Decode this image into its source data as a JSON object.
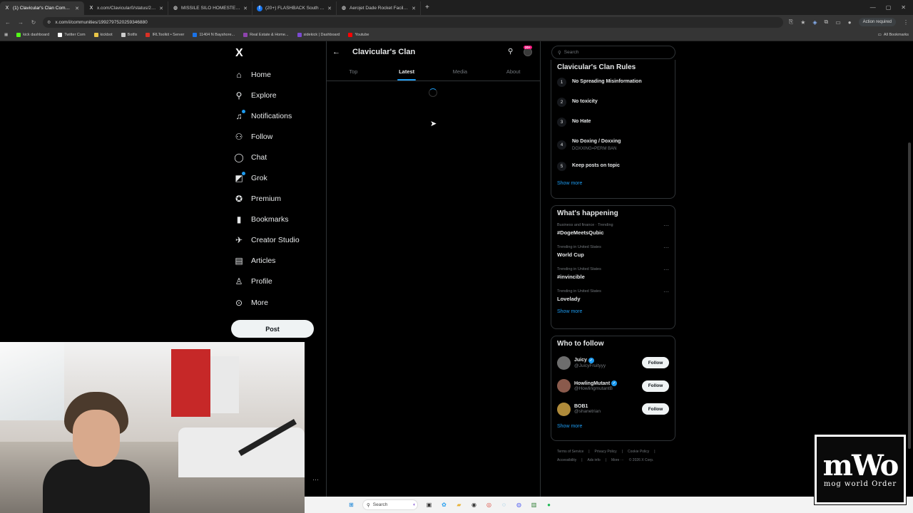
{
  "browser": {
    "tabs": [
      {
        "favicon": "X",
        "title": "(1) Clavicular's Clan Communit",
        "active": true
      },
      {
        "favicon": "X",
        "title": "x.com/Clavicular0/status/2039",
        "active": false
      },
      {
        "favicon": "◍",
        "title": "MISSILE SILO HOMESTEAD - Gr",
        "active": false
      },
      {
        "favicon": "f",
        "title": "(20+) FLASHBACK South Florid",
        "active": false
      },
      {
        "favicon": "◍",
        "title": "Aerojet Dade Rocket Facility | #",
        "active": false
      }
    ],
    "new_tab": "+",
    "url": "x.com/i/communities/1992797520259346880",
    "action_required": "Action required",
    "bookmarks": [
      {
        "label": "kick dashboard",
        "color": "#53fc18"
      },
      {
        "label": "Twitter Com",
        "color": "#ffffff"
      },
      {
        "label": "kickbot",
        "color": "#e8c547"
      },
      {
        "label": "Botfix",
        "color": "#cccccc"
      },
      {
        "label": "IRLToolkit • Server",
        "color": "#d93025"
      },
      {
        "label": "11404 N Bayshore...",
        "color": "#1a73e8"
      },
      {
        "label": "Real Estate & Home...",
        "color": "#8e44ad"
      },
      {
        "label": "sidekick | Dashboard",
        "color": "#7b4ad1"
      },
      {
        "label": "Youtube",
        "color": "#ff0000"
      }
    ],
    "all_bookmarks": "All Bookmarks"
  },
  "leftnav": {
    "logo": "X",
    "items": [
      {
        "label": "Home",
        "icon": "⌂"
      },
      {
        "label": "Explore",
        "icon": "⚲"
      },
      {
        "label": "Notifications",
        "icon": "🔔"
      },
      {
        "label": "Follow",
        "icon": "+"
      },
      {
        "label": "Chat",
        "icon": "◯"
      },
      {
        "label": "Grok",
        "icon": "◩"
      },
      {
        "label": "Premium",
        "icon": "✓"
      },
      {
        "label": "Bookmarks",
        "icon": "▮"
      },
      {
        "label": "Creator Studio",
        "icon": "✈"
      },
      {
        "label": "Articles",
        "icon": "▤"
      },
      {
        "label": "Profile",
        "icon": "♙"
      },
      {
        "label": "More",
        "icon": "⋯"
      }
    ],
    "post": "Post"
  },
  "community": {
    "title": "Clavicular's Clan",
    "badge": "20+",
    "tabs": [
      "Top",
      "Latest",
      "Media",
      "About"
    ],
    "active_tab": "Latest"
  },
  "sidebar": {
    "search_placeholder": "Search",
    "rules_title": "Clavicular's Clan Rules",
    "rules": [
      {
        "num": "1",
        "text": "No Spreading Misinformation",
        "sub": ""
      },
      {
        "num": "2",
        "text": "No toxicity",
        "sub": ""
      },
      {
        "num": "3",
        "text": "No Hate",
        "sub": ""
      },
      {
        "num": "4",
        "text": "No Doxing / Doxxing",
        "sub": "DOXXING=PERM BAN"
      },
      {
        "num": "5",
        "text": "Keep posts on topic",
        "sub": ""
      }
    ],
    "show_more": "Show more",
    "happening_title": "What's happening",
    "trends": [
      {
        "meta": "Business and finance · Trending",
        "name": "#DogeMeetsQubic"
      },
      {
        "meta": "Trending in United States",
        "name": "World Cup"
      },
      {
        "meta": "Trending in United States",
        "name": "#invincible"
      },
      {
        "meta": "Trending in United States",
        "name": "Lovelady"
      }
    ],
    "wtf_title": "Who to follow",
    "who": [
      {
        "name": "Juicy",
        "handle": "@JuicyFruityyy",
        "verified": true
      },
      {
        "name": "HowlingMutant",
        "handle": "@HowlingmutantB",
        "verified": true
      },
      {
        "name": "BOB1",
        "handle": "@shanetrian",
        "verified": false
      }
    ],
    "follow": "Follow",
    "footer": [
      "Terms of Service",
      "|",
      "Privacy Policy",
      "|",
      "Cookie Policy",
      "|",
      "Accessibility",
      "|",
      "Ads info",
      "|",
      "More ···",
      "© 2026 X Corp."
    ]
  },
  "taskbar": {
    "search": "Search"
  },
  "watermark": {
    "big": "mWo",
    "small": "mog world Order"
  }
}
